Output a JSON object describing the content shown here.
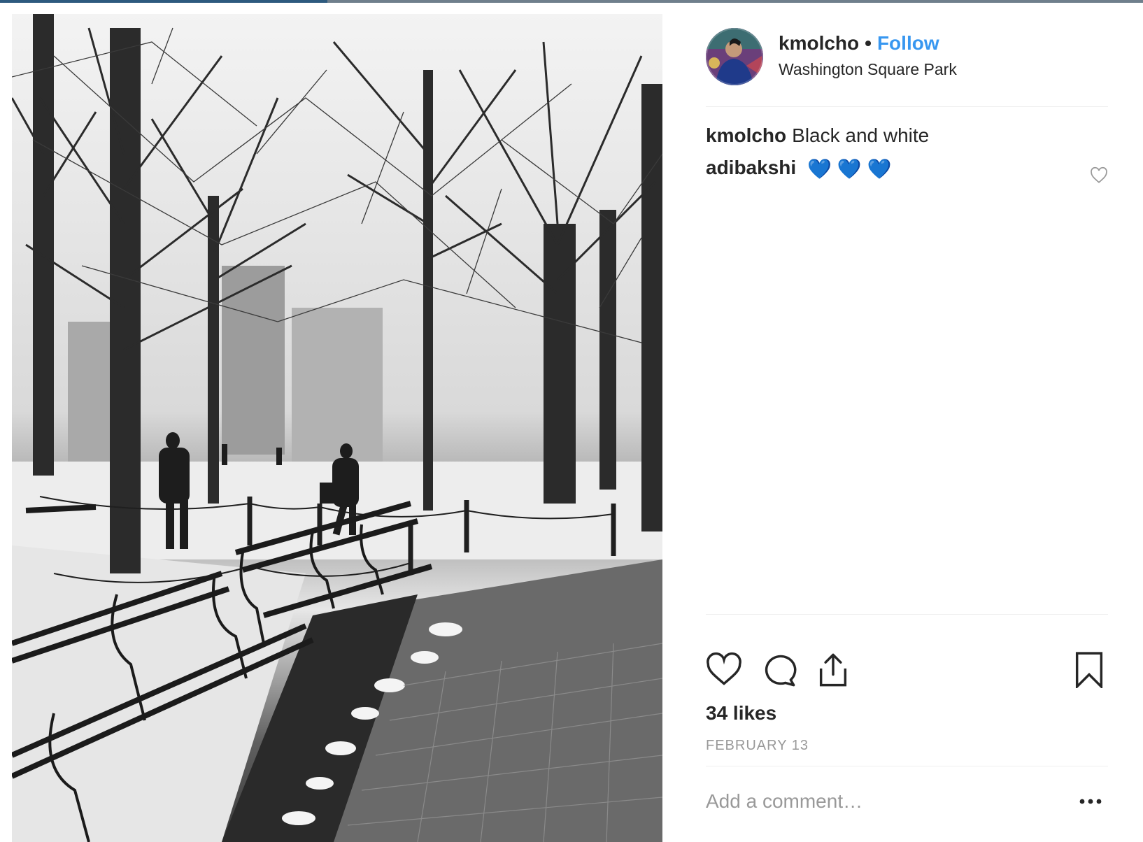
{
  "post": {
    "username": "kmolcho",
    "separator": "•",
    "follow_label": "Follow",
    "location": "Washington Square Park"
  },
  "comments": [
    {
      "user": "kmolcho",
      "text": "Black and white"
    },
    {
      "user": "adibakshi",
      "emoji": [
        "💙",
        "💙",
        "💙"
      ]
    }
  ],
  "stats": {
    "likes": "34 likes",
    "date": "FEBRUARY 13"
  },
  "comment_box": {
    "placeholder": "Add a comment…"
  },
  "icons": [
    "like-heart-icon",
    "comment-bubble-icon",
    "share-icon",
    "bookmark-icon",
    "comment-like-heart-icon",
    "more-options-icon"
  ],
  "colors": {
    "follow": "#3897f0",
    "muted": "#999999",
    "text": "#262626",
    "emoji_heart": "#1877f2"
  }
}
